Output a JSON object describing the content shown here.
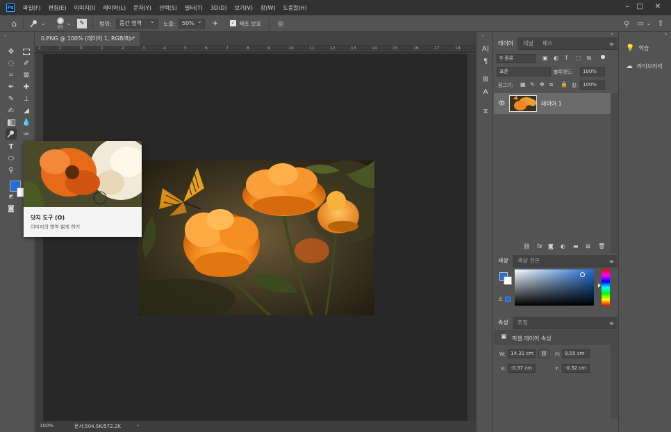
{
  "menu": {
    "logo": "Ps",
    "items": [
      "파일(F)",
      "편집(E)",
      "이미지(I)",
      "레이어(L)",
      "문자(Y)",
      "선택(S)",
      "필터(T)",
      "3D(D)",
      "보기(V)",
      "창(W)",
      "도움말(H)"
    ]
  },
  "options": {
    "brush_size": "65",
    "range_label": "범위:",
    "range_value": "중간 영역",
    "exposure_label": "노출:",
    "exposure_value": "50%",
    "protect_tones_label": "색조 보호"
  },
  "document": {
    "tab_title": "0.PNG @ 100% (레이어 1, RGB/8) *",
    "close_glyph": "×",
    "ruler_ticks": [
      "2",
      "1",
      "0",
      "1",
      "2",
      "3",
      "4",
      "5",
      "6",
      "7",
      "8",
      "9",
      "10",
      "11",
      "12",
      "13",
      "14",
      "15",
      "16",
      "17",
      "18"
    ],
    "zoom": "100%",
    "doc_info": "문서:504.5K/572.2K"
  },
  "tooltip": {
    "title": "닷지 도구 (O)",
    "description": "이미지의 영역 밝게 하기"
  },
  "layers_panel": {
    "tabs": [
      "레이어",
      "채널",
      "패스"
    ],
    "filter_kind": "종류",
    "blend_mode": "표준",
    "opacity_label": "불투명도:",
    "opacity_value": "100%",
    "lock_label": "잠그기:",
    "fill_label": "칠:",
    "fill_value": "100%",
    "layers": [
      {
        "name": "레이어 1"
      }
    ]
  },
  "color_panel": {
    "tabs": [
      "색상",
      "색상 견본"
    ],
    "foreground": "#1f6fd6",
    "background": "#ffffff"
  },
  "properties_panel": {
    "tabs": [
      "속성",
      "조정"
    ],
    "title": "픽셀 레이어 속성",
    "w_label": "W:",
    "w_value": "14.31 cm",
    "h_label": "H:",
    "h_value": "9.55 cm",
    "x_label": "X:",
    "x_value": "-0.37 cm",
    "y_label": "Y:",
    "y_value": "-0.32 cm"
  },
  "right_panel": {
    "items": [
      {
        "label": "학습",
        "icon": "lightbulb-icon"
      },
      {
        "label": "라이브러리",
        "icon": "libraries-icon"
      }
    ]
  }
}
